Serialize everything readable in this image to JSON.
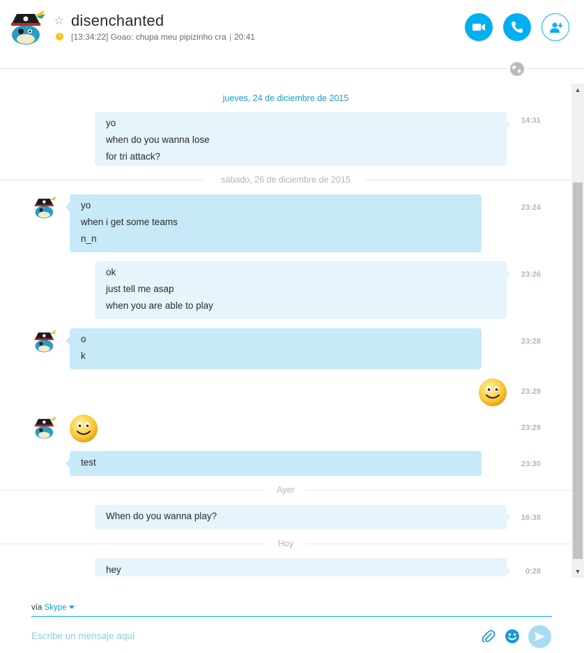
{
  "header": {
    "contact_name": "disenchanted",
    "mood_message": "[13:34:22] Goao: chupa meu pipizinho cra",
    "mood_time": "20:41",
    "avatar_icon": "pirate-avatar-icon",
    "buttons": {
      "video": "video-call-icon",
      "call": "audio-call-icon",
      "add": "add-contact-icon"
    }
  },
  "chat": {
    "separators": [
      {
        "label": "jueves, 24 de diciembre de 2015"
      },
      {
        "label": "sábado, 26 de diciembre de 2015"
      },
      {
        "label": "Ayer"
      },
      {
        "label": "Hoy"
      }
    ],
    "messages": [
      {
        "dir": "out",
        "lines": [
          "yo",
          "when do you wanna lose",
          "for tri attack?"
        ],
        "time": "14:31"
      },
      {
        "dir": "in",
        "lines": [
          "yo",
          "when i get some teams",
          "n_n"
        ],
        "time": "23:24"
      },
      {
        "dir": "out",
        "lines": [
          "ok",
          "just tell me asap",
          "when you are able to play"
        ],
        "time": "23:26"
      },
      {
        "dir": "in",
        "lines": [
          "o",
          "k"
        ],
        "time": "23:28"
      },
      {
        "dir": "out",
        "emoji": "smile-emoticon",
        "time": "23:29"
      },
      {
        "dir": "in",
        "emoji": "smile-emoticon",
        "time": "23:29"
      },
      {
        "dir": "in",
        "lines": [
          "test"
        ],
        "time": "23:30"
      },
      {
        "dir": "out",
        "lines": [
          "When do you wanna play?"
        ],
        "time": "16:38"
      },
      {
        "dir": "out",
        "lines": [
          "hey"
        ],
        "time": "0:28"
      }
    ]
  },
  "composer": {
    "via_label": "vía",
    "via_service": "Skype",
    "placeholder": "Escribe un mensaje aquí"
  },
  "colors": {
    "accent": "#00aff0",
    "bubble_out": "#e6f4fb",
    "bubble_in": "#c7e9f8",
    "timestamp": "#a9b8c4"
  }
}
